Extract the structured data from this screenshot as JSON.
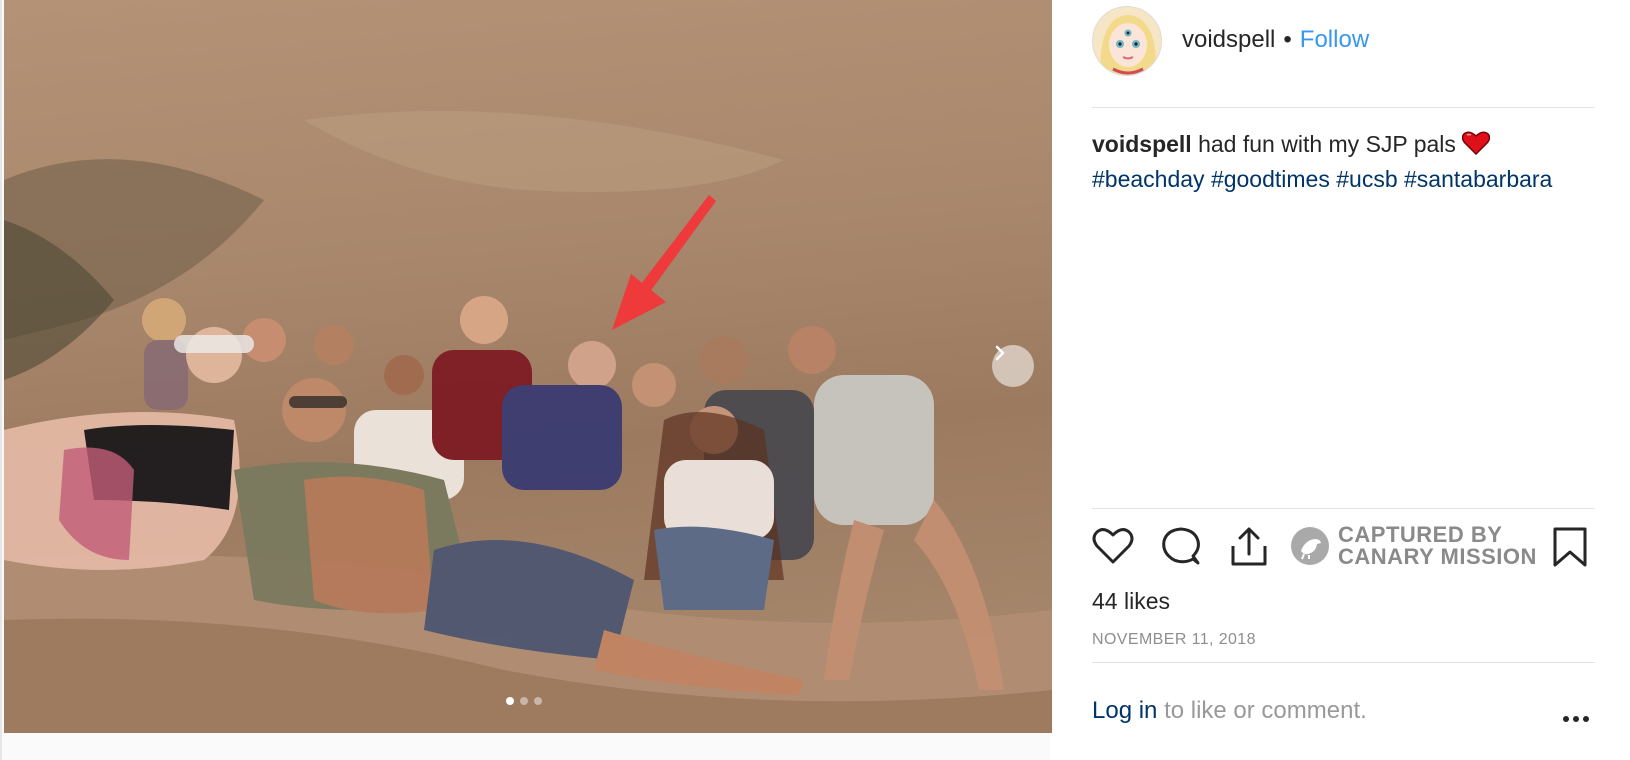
{
  "post": {
    "username": "voidspell",
    "separator": "•",
    "follow_label": "Follow",
    "caption_text": "had fun with my SJP pals",
    "caption_emoji": "red-heart-emoji",
    "hashtags": [
      "#beachday",
      "#goodtimes",
      "#ucsb",
      "#santabarbara"
    ],
    "likes": "44 likes",
    "date": "NOVEMBER 11, 2018"
  },
  "photo": {
    "description_icon": "group-beach-photo",
    "carousel": {
      "count": 3,
      "active_index": 0
    }
  },
  "actions": {
    "icons": [
      "heart-icon",
      "comment-icon",
      "share-icon",
      "bookmark-icon"
    ],
    "stamp_line1": "CAPTURED BY",
    "stamp_line2": "CANARY MISSION"
  },
  "footer": {
    "login_link": "Log in",
    "login_rest": "to like or comment."
  },
  "colors": {
    "link": "#3897f0",
    "hashtag": "#003569",
    "arrow": "#ee3a3a",
    "heart": "#e0101a",
    "muted": "#8e8e8e"
  }
}
